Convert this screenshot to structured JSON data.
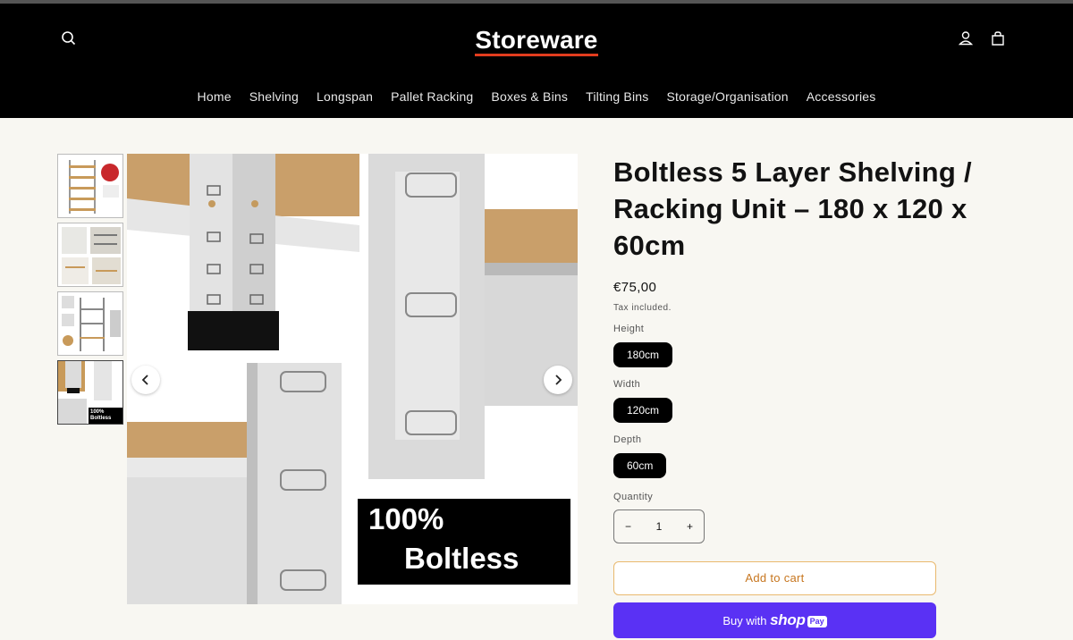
{
  "header": {
    "logo": "Storeware",
    "search_icon": "search-icon",
    "account_icon": "account-icon",
    "cart_icon": "cart-icon"
  },
  "nav": {
    "items": [
      "Home",
      "Shelving",
      "Longspan",
      "Pallet Racking",
      "Boxes & Bins",
      "Tilting Bins",
      "Storage/Organisation",
      "Accessories"
    ]
  },
  "gallery": {
    "image_caption": "100% Boltless",
    "caption_line1": "100%",
    "caption_line2": "Boltless",
    "thumb4_caption": "100% Boltless",
    "prev_icon": "chevron-left-icon",
    "next_icon": "chevron-right-icon",
    "thumbnail_count": 4,
    "active_thumbnail": 4
  },
  "product": {
    "title": "Boltless 5 Layer Shelving / Racking Unit – 180 x 120 x 60cm",
    "price": "€75,00",
    "tax_note": "Tax included.",
    "options": {
      "height_label": "Height",
      "height_value": "180cm",
      "width_label": "Width",
      "width_value": "120cm",
      "depth_label": "Depth",
      "depth_value": "60cm"
    },
    "quantity_label": "Quantity",
    "quantity_value": "1",
    "minus": "−",
    "plus": "+",
    "add_to_cart": "Add to cart",
    "buy_with": "Buy with",
    "shop_word": "shop",
    "pay_badge": "Pay"
  },
  "colors": {
    "header_bg": "#000000",
    "logo_underline": "#e23c1e",
    "shop_pay": "#5a31f4",
    "cart_border": "#e9b96e"
  }
}
